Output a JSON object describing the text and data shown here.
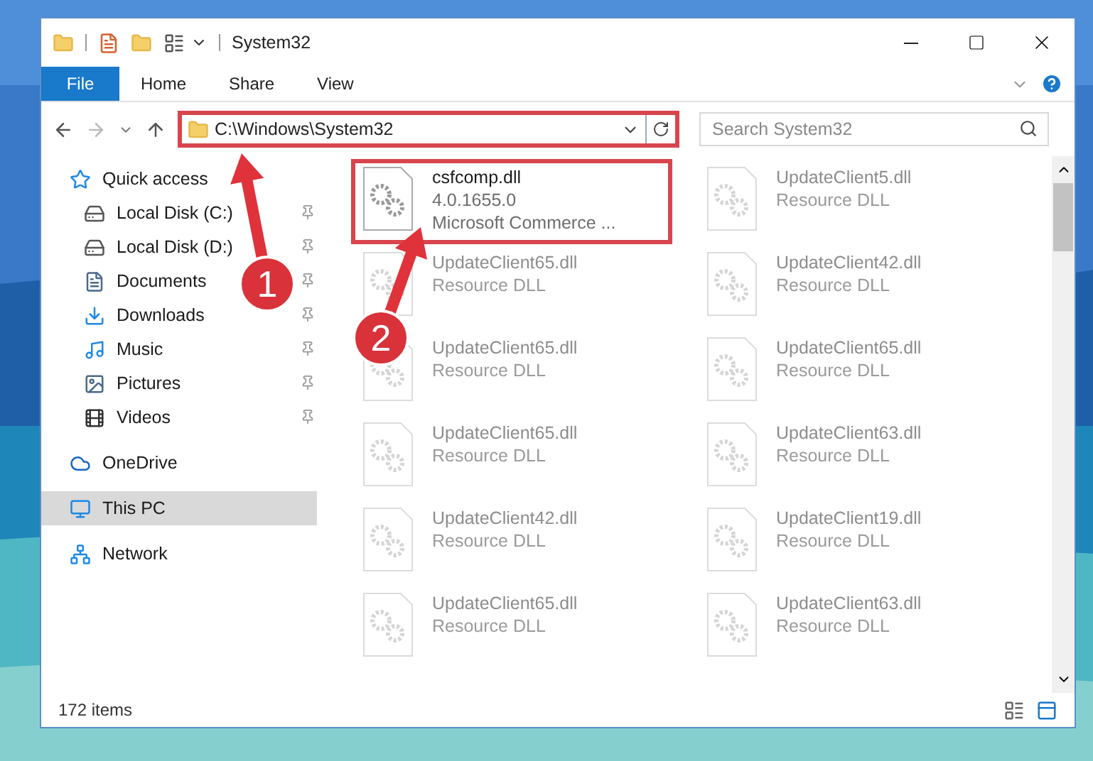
{
  "window": {
    "title": "System32"
  },
  "ribbon_tabs": [
    {
      "label": "File",
      "kind": "file",
      "selected": false
    },
    {
      "label": "Home",
      "kind": "tab",
      "selected": false
    },
    {
      "label": "Share",
      "kind": "tab",
      "selected": false
    },
    {
      "label": "View",
      "kind": "tab",
      "selected": false
    }
  ],
  "address": {
    "path": "C:\\Windows\\System32",
    "highlighted": true
  },
  "search": {
    "placeholder": "Search System32"
  },
  "sidebar": {
    "items": [
      {
        "label": "Quick access",
        "selected": false,
        "children": [
          {
            "label": "Local Disk (C:)",
            "pinned": true,
            "selected": false
          },
          {
            "label": "Local Disk (D:)",
            "pinned": true,
            "selected": false
          },
          {
            "label": "Documents",
            "pinned": true,
            "selected": false
          },
          {
            "label": "Downloads",
            "pinned": true,
            "selected": false
          },
          {
            "label": "Music",
            "pinned": true,
            "selected": false
          },
          {
            "label": "Pictures",
            "pinned": true,
            "selected": false
          },
          {
            "label": "Videos",
            "pinned": true,
            "selected": false
          }
        ]
      },
      {
        "label": "OneDrive",
        "selected": false
      },
      {
        "label": "This PC",
        "selected": true
      },
      {
        "label": "Network",
        "selected": false
      }
    ]
  },
  "files": [
    {
      "name": "csfcomp.dll",
      "details": [
        "4.0.1655.0",
        "Microsoft Commerce ..."
      ],
      "faded": false,
      "highlighted": true
    },
    {
      "name": "UpdateClient5.dll",
      "details": [
        "Resource DLL"
      ],
      "faded": true,
      "highlighted": false
    },
    {
      "name": "UpdateClient65.dll",
      "details": [
        "Resource DLL"
      ],
      "faded": true,
      "highlighted": false
    },
    {
      "name": "UpdateClient42.dll",
      "details": [
        "Resource DLL"
      ],
      "faded": true,
      "highlighted": false
    },
    {
      "name": "UpdateClient65.dll",
      "details": [
        "Resource DLL"
      ],
      "faded": true,
      "highlighted": false
    },
    {
      "name": "UpdateClient65.dll",
      "details": [
        "Resource DLL"
      ],
      "faded": true,
      "highlighted": false
    },
    {
      "name": "UpdateClient65.dll",
      "details": [
        "Resource DLL"
      ],
      "faded": true,
      "highlighted": false
    },
    {
      "name": "UpdateClient63.dll",
      "details": [
        "Resource DLL"
      ],
      "faded": true,
      "highlighted": false
    },
    {
      "name": "UpdateClient42.dll",
      "details": [
        "Resource DLL"
      ],
      "faded": true,
      "highlighted": false
    },
    {
      "name": "UpdateClient19.dll",
      "details": [
        "Resource DLL"
      ],
      "faded": true,
      "highlighted": false
    },
    {
      "name": "UpdateClient65.dll",
      "details": [
        "Resource DLL"
      ],
      "faded": true,
      "highlighted": false
    },
    {
      "name": "UpdateClient63.dll",
      "details": [
        "Resource DLL"
      ],
      "faded": true,
      "highlighted": false
    }
  ],
  "status_bar": {
    "count": "172 items"
  },
  "annotations": [
    {
      "number": "1"
    },
    {
      "number": "2"
    }
  ]
}
